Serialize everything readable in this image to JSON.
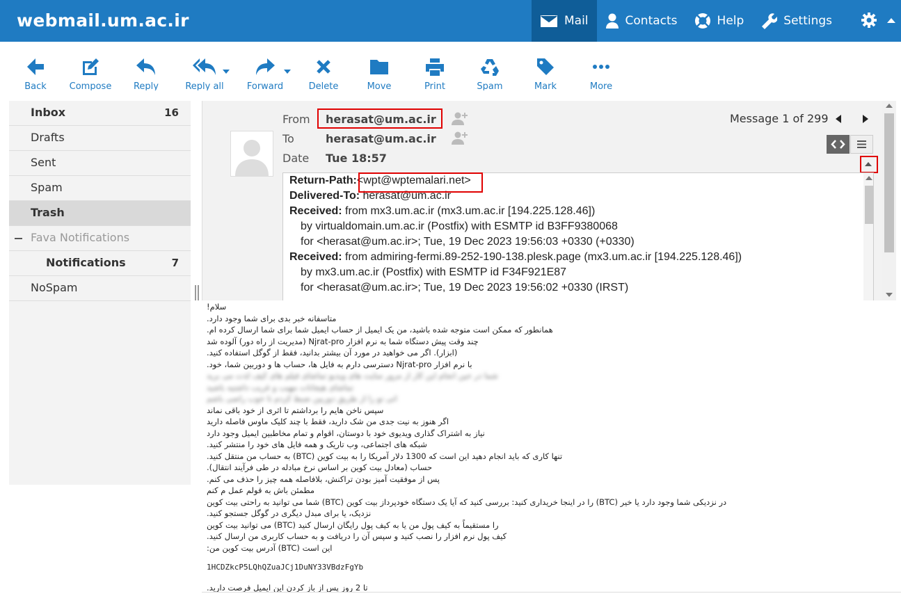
{
  "app": {
    "title": "webmail.um.ac.ir"
  },
  "topnav": [
    {
      "label": "Mail",
      "icon": "envelope-icon",
      "active": true
    },
    {
      "label": "Contacts",
      "icon": "user-icon",
      "active": false
    },
    {
      "label": "Help",
      "icon": "lifebuoy-icon",
      "active": false
    },
    {
      "label": "Settings",
      "icon": "wrench-icon",
      "active": false
    }
  ],
  "toolbar": {
    "back": "Back",
    "compose": "Compose",
    "reply": "Reply",
    "reply_all": "Reply all",
    "forward": "Forward",
    "delete": "Delete",
    "move": "Move",
    "print": "Print",
    "spam": "Spam",
    "mark": "Mark",
    "more": "More"
  },
  "folders": [
    {
      "label": "Inbox",
      "count": "16"
    },
    {
      "label": "Drafts"
    },
    {
      "label": "Sent"
    },
    {
      "label": "Spam"
    },
    {
      "label": "Trash"
    },
    {
      "label": "Fava Notifications"
    },
    {
      "label": "Notifications",
      "count": "7"
    },
    {
      "label": "NoSpam"
    }
  ],
  "message": {
    "from_label": "From",
    "from": "herasat@um.ac.ir",
    "to_label": "To",
    "to": "herasat@um.ac.ir",
    "date_label": "Date",
    "date": "Tue 18:57",
    "counter": "Message 1 of 299"
  },
  "raw_headers": [
    {
      "key": "Return-Path:",
      "value": "<wpt@wptemalari.net>"
    },
    {
      "key": "Delivered-To:",
      "value": " herasat@um.ac.ir"
    },
    {
      "key": "Received:",
      "value": " from mx3.um.ac.ir (mx3.um.ac.ir [194.225.128.46])"
    },
    {
      "cont": "by virtualdomain.um.ac.ir (Postfix) with ESMTP id B3FF9380068"
    },
    {
      "cont": "for <herasat@um.ac.ir>; Tue, 19 Dec 2023 19:56:03 +0330 (+0330)"
    },
    {
      "key": "Received:",
      "value": " from admiring-fermi.89-252-190-138.plesk.page (mx3.um.ac.ir [194.225.128.46])"
    },
    {
      "cont": "by mx3.um.ac.ir (Postfix) with ESMTP id F34F921E87"
    },
    {
      "cont": "for <herasat@um.ac.ir>; Tue, 19 Dec 2023 19:56:02 +0330 (IRST)"
    }
  ],
  "body": {
    "lines": [
      "سلام!",
      "متاسفانه خبر بدی برای شما وجود دارد.",
      "همانطور که ممکن است متوجه شده باشید، من یک ایمیل از حساب ایمیل شما برای شما ارسال کرده ام.",
      "چند وقت پیش دستگاه شما به نرم افزار Njrat-pro (مدیریت از راه دور) آلوده شد",
      "(ابزار). اگر می خواهید در مورد آن بیشتر بدانید، فقط از گوگل استفاده کنید.",
      "با نرم افزار Njrat-pro دسترسی دارم به فایل ها، حساب ها و دوربین شما، خود."
    ],
    "blurred_lines": [
      "شما در حین انجام این کار از مرور سایت های ویدیو تماشای فیلم های کیف لذت می برید",
      "تماشای هیجانات مهیب و غریب داشتیه باشید",
      "اتی تو را از طریق دوربین ضبط کردم تا خوب راضی باشم"
    ],
    "lines2": [
      "سپس ناخن هایم را برداشتم تا اثری از خود باقی نماند",
      "اگر هنوز به نیت جدی من شک دارید، فقط با چند کلیک ماوس فاصله دارید",
      "نیاز به اشتراک گذاری ویدیوی خود با دوستان، اقوام و تمام مخاطبین ایمیل وجود دارد",
      "شبکه های اجتماعی، وب تاریک و همه فایل های خود را منتشر کنید.",
      "تنها کاری که باید انجام دهید این است که 1300 دلار آمریکا را به بیت کوین (BTC) به حساب من منتقل کنید.",
      "حساب (معادل بیت کوین بر اساس نرخ مبادله در طی فرآیند انتقال).",
      "پس از موفقیت آمیز بودن تراکنش، بلافاصله همه چیز را حذف می کنم.",
      "مطمئن باش به قولم عمل م کنم",
      "در نزدیکی شما وجود دارد یا خیر (BTC) را در اینجا خریداری کنید: بررسی کنید که آیا یک دستگاه خودپرداز بیت کوین (BTC) شما می توانید به راحتی بیت کوین",
      "نزدیک، یا برای مبدل دیگری در گوگل جستجو کنید.",
      "را مستقیماً به کیف پول من یا به کیف پول رایگان ارسال کنید (BTC) می توانید بیت کوین",
      "کیف پول نرم افزار را نصب کنید و سپس آن را دریافت و به حساب کاربری من ارسال کنید.",
      "این است (BTC) آدرس بیت کوین من:"
    ],
    "btc_address": "1HCDZkcP5LQhQZuaJCj1DuNY33VBdzFgYb",
    "closing": "تا 2 روز پس از باز کردن این ایمیل فرصت دارید."
  }
}
